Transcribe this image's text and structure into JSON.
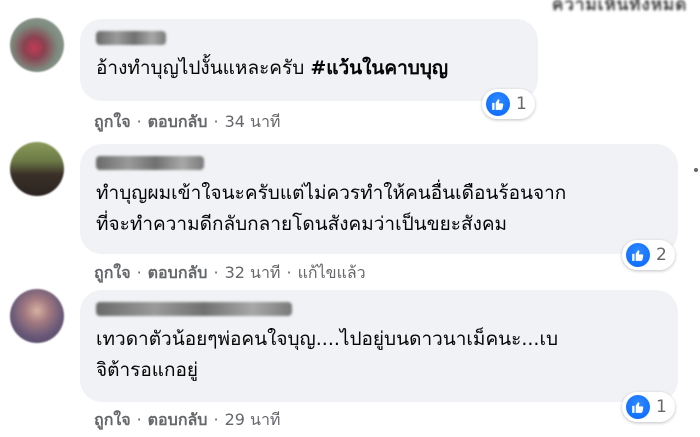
{
  "header": {
    "fragment": "ความเห็นทั้งหมด"
  },
  "comments": [
    {
      "text": "อ้างทำบุญไปงั้นแหละครับ ",
      "hashtag": "#แว้นในคาบบุญ",
      "like": "ถูกใจ",
      "reply": "ตอบกลับ",
      "time": "34 นาที",
      "reactions": "1"
    },
    {
      "text": "ทำบุญผมเข้าใจนะครับแต่ไม่ควรทำให้คนอื่นเดือนร้อนจาก\nที่จะทำความดีกลับกลายโดนสังคมว่าเป็นขยะสังคม",
      "like": "ถูกใจ",
      "reply": "ตอบกลับ",
      "time": "32 นาที",
      "edited": "แก้ไขแล้ว",
      "reactions": "2"
    },
    {
      "text": "เทวดาตัวน้อยๆพ่อคนใจบุญ....ไปอยู่บนดาวนาเม็คนะ...เบ\nจิต้ารอแกอยู่",
      "like": "ถูกใจ",
      "reply": "ตอบกลับ",
      "time": "29 นาที",
      "reactions": "1"
    }
  ],
  "colors": {
    "bubble": "#f0f2f5",
    "like_blue": "#0866ff",
    "meta_gray": "#65676b"
  },
  "icons": {
    "reaction": "like-thumb-icon"
  }
}
